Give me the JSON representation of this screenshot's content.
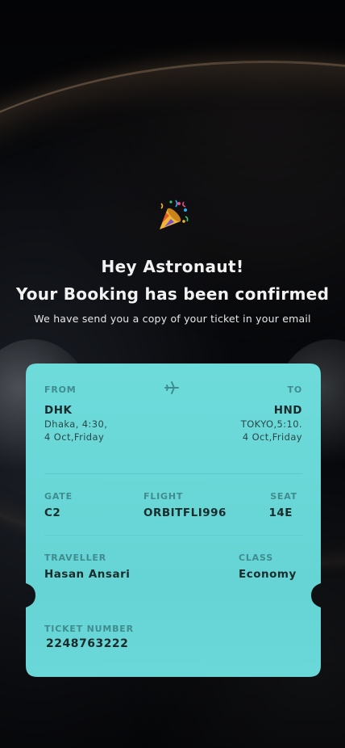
{
  "header": {
    "emoji": "🎉",
    "greeting": "Hey Astronaut!",
    "title": "Your Booking has been confirmed",
    "subtitle": "We have send you a copy of your ticket in your email"
  },
  "ticket": {
    "from_label": "FROM",
    "to_label": "TO",
    "from_code": "DHK",
    "from_city_time": "Dhaka, 4:30,",
    "from_date": "4 Oct,Friday",
    "to_code": "HND",
    "to_city_time": "TOKYO,5:10.",
    "to_date": "4 Oct,Friday",
    "gate_label": "GATE",
    "gate_value": "C2",
    "flight_label": "FLIGHT",
    "flight_value": "ORBITFLI996",
    "seat_label": "SEAT",
    "seat_value": "14E",
    "traveller_label": "TRAVELLER",
    "traveller_value": "Hasan Ansari",
    "class_label": "CLASS",
    "class_value": "Economy",
    "ticket_number_label": "TICKET NUMBER",
    "ticket_number_value": "2248763222",
    "colors": {
      "card": "#6ad8d8",
      "label": "#3f8c8e",
      "text": "#1a2b2c"
    }
  }
}
